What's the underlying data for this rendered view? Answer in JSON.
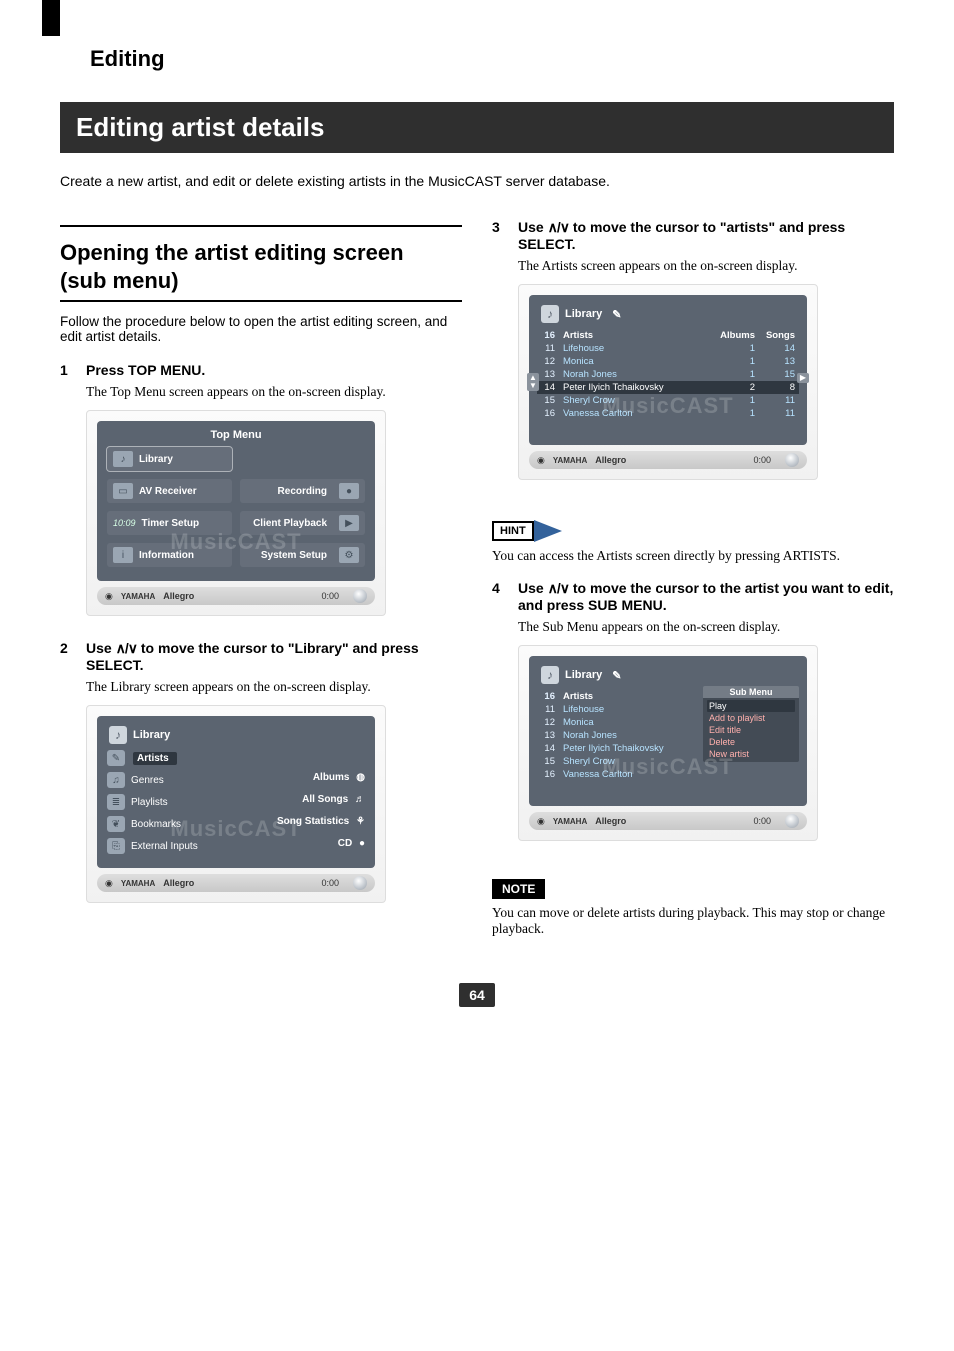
{
  "chapter": "Editing",
  "section_title": "Editing artist details",
  "intro": "Create a new artist, and edit or delete existing artists in the MusicCAST server database.",
  "subsection_title_line1": "Opening the artist editing screen",
  "subsection_title_line2": "(sub menu)",
  "subsection_lead": "Follow the procedure below to open the artist editing screen, and edit artist details.",
  "arrows_glyph": "∧/∨",
  "watermark": "MusicCAST",
  "status": {
    "brand": "YAMAHA",
    "track": "Allegro",
    "time": "0:00"
  },
  "steps": {
    "s1": {
      "num": "1",
      "title": "Press TOP MENU.",
      "body": "The Top Menu screen appears on the on-screen display."
    },
    "s2": {
      "num": "2",
      "title_pre": "Use ",
      "title_post": " to move the cursor to \"Library\" and press SELECT.",
      "body": "The Library screen appears on the on-screen display."
    },
    "s3": {
      "num": "3",
      "title_pre": "Use ",
      "title_post": " to move the cursor to \"artists\" and press SELECT.",
      "body": "The Artists screen appears on the on-screen display."
    },
    "s4": {
      "num": "4",
      "title_pre": "Use ",
      "title_post": " to move the cursor to the artist you want to edit, and press SUB MENU.",
      "body": "The Sub Menu appears on the on-screen display."
    }
  },
  "shot_topmenu": {
    "header": "Library",
    "title": "Top Menu",
    "clock": "10:09",
    "tiles_left": [
      "Library",
      "AV Receiver",
      "Timer Setup",
      "Information"
    ],
    "tiles_right": [
      "Recording",
      "Client Playback",
      "System Setup"
    ]
  },
  "shot_library": {
    "header": "Library",
    "left_items": [
      "Artists",
      "Genres",
      "Playlists",
      "Bookmarks",
      "External Inputs"
    ],
    "right_items": [
      "Albums",
      "All Songs",
      "Song Statistics",
      "CD"
    ]
  },
  "shot_artists": {
    "header": "Library",
    "count_label": "Artists",
    "count": "16",
    "col_albums": "Albums",
    "col_songs": "Songs",
    "rows": [
      {
        "idx": "11",
        "name": "Lifehouse",
        "albums": "1",
        "songs": "14"
      },
      {
        "idx": "12",
        "name": "Monica",
        "albums": "1",
        "songs": "13"
      },
      {
        "idx": "13",
        "name": "Norah Jones",
        "albums": "1",
        "songs": "15"
      },
      {
        "idx": "14",
        "name": "Peter Ilyich Tchaikovsky",
        "albums": "2",
        "songs": "8",
        "sel": true
      },
      {
        "idx": "15",
        "name": "Sheryl Crow",
        "albums": "1",
        "songs": "11"
      },
      {
        "idx": "16",
        "name": "Vanessa Carlton",
        "albums": "1",
        "songs": "11"
      }
    ]
  },
  "shot_submenu": {
    "header": "Library",
    "count_label": "Artists",
    "count": "16",
    "rows": [
      {
        "idx": "11",
        "name": "Lifehouse"
      },
      {
        "idx": "12",
        "name": "Monica"
      },
      {
        "idx": "13",
        "name": "Norah Jones"
      },
      {
        "idx": "14",
        "name": "Peter Ilyich Tchaikovsky"
      },
      {
        "idx": "15",
        "name": "Sheryl Crow"
      },
      {
        "idx": "16",
        "name": "Vanessa Carlton"
      }
    ],
    "menu_title": "Sub Menu",
    "menu_items": [
      "Play",
      "Add to playlist",
      "Edit title",
      "Delete",
      "New artist"
    ],
    "menu_sel": 0
  },
  "hint": {
    "label": "HINT",
    "body": "You can access the Artists screen directly by pressing ARTISTS."
  },
  "note": {
    "label": "NOTE",
    "body": "You can move or delete artists during playback. This may stop or change playback."
  },
  "page_number": "64"
}
